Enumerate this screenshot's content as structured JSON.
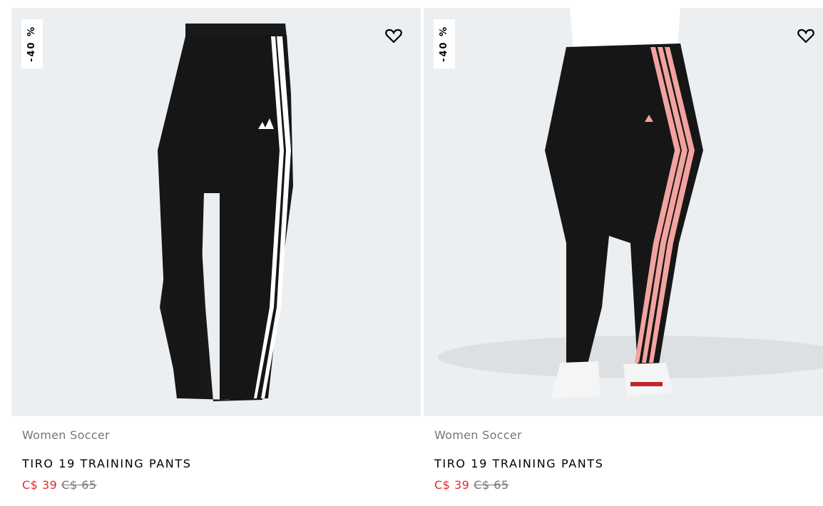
{
  "products": [
    {
      "discount_badge": "-40 %",
      "category": "Women Soccer",
      "title": "TIRO 19 TRAINING PANTS",
      "sale_price": "C$ 39",
      "original_price": "C$ 65",
      "stripe_color": "#ffffff",
      "image_icon": "pants-flat-icon"
    },
    {
      "discount_badge": "-40 %",
      "category": "Women Soccer",
      "title": "TIRO 19 TRAINING PANTS",
      "sale_price": "C$ 39",
      "original_price": "C$ 65",
      "stripe_color": "#f2a3a0",
      "image_icon": "pants-model-icon"
    }
  ],
  "colors": {
    "image_bg": "#eceff1",
    "sale_red": "#e32b2b",
    "muted_gray": "#767677"
  }
}
